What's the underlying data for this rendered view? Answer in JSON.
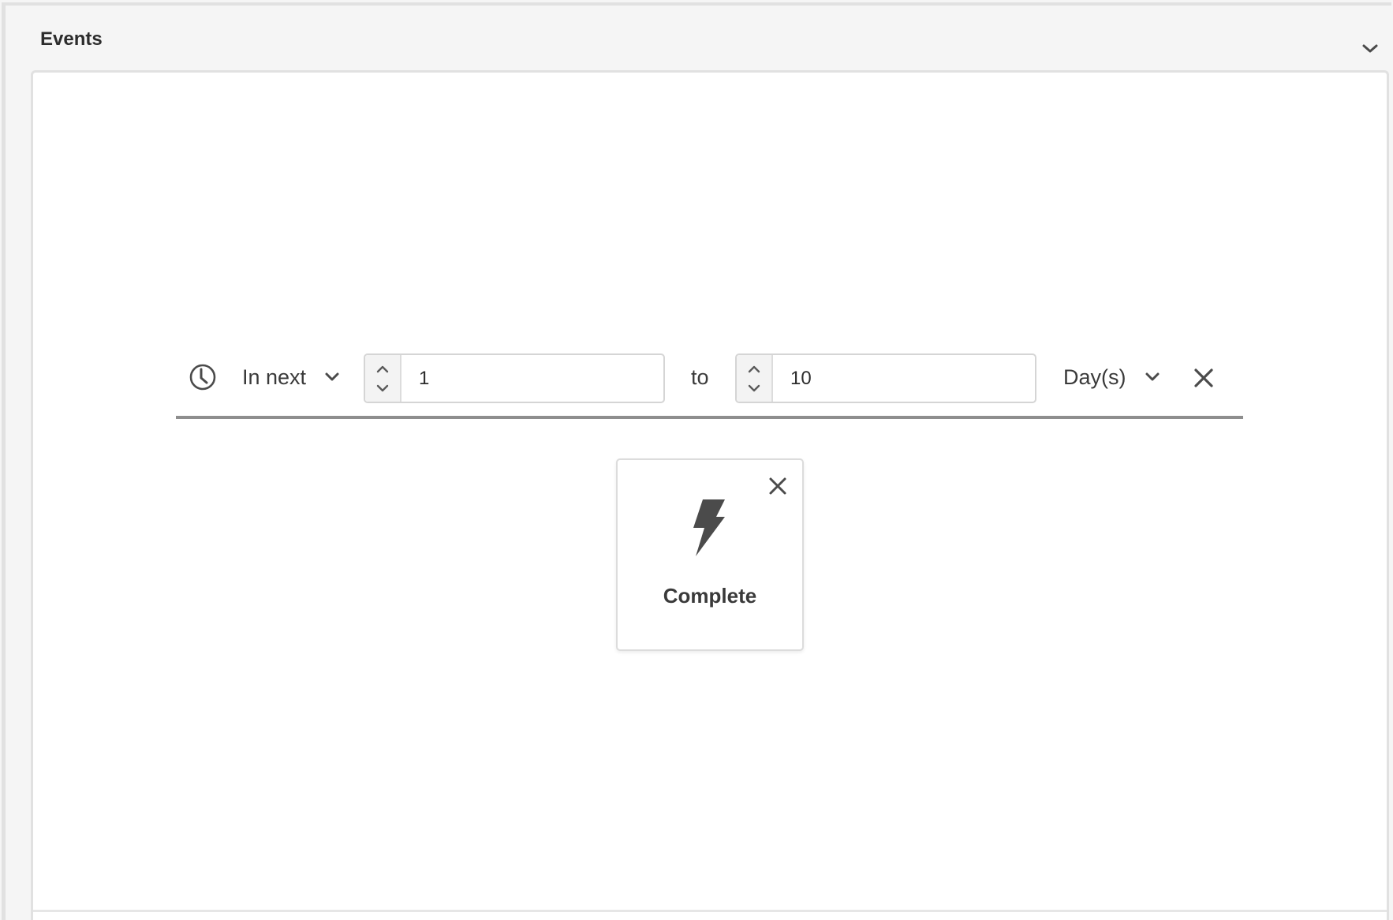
{
  "panel": {
    "title": "Events",
    "collapse_icon": "chevron-down-icon"
  },
  "time_constraint": {
    "icon": "clock-icon",
    "when_dropdown": {
      "selected": "In next"
    },
    "range_start": {
      "value": "1"
    },
    "separator": "to",
    "range_end": {
      "value": "10"
    },
    "unit_dropdown": {
      "selected": "Day(s)"
    },
    "remove_icon": "close-icon"
  },
  "event_card": {
    "icon": "lightning-bolt-icon",
    "label": "Complete",
    "remove_icon": "close-icon"
  },
  "colors": {
    "page_background": "#f5f5f5",
    "canvas_background": "#ffffff",
    "border": "#e1e1e1",
    "icon": "#4b4b4b",
    "row_underline": "#8e8e8e"
  }
}
